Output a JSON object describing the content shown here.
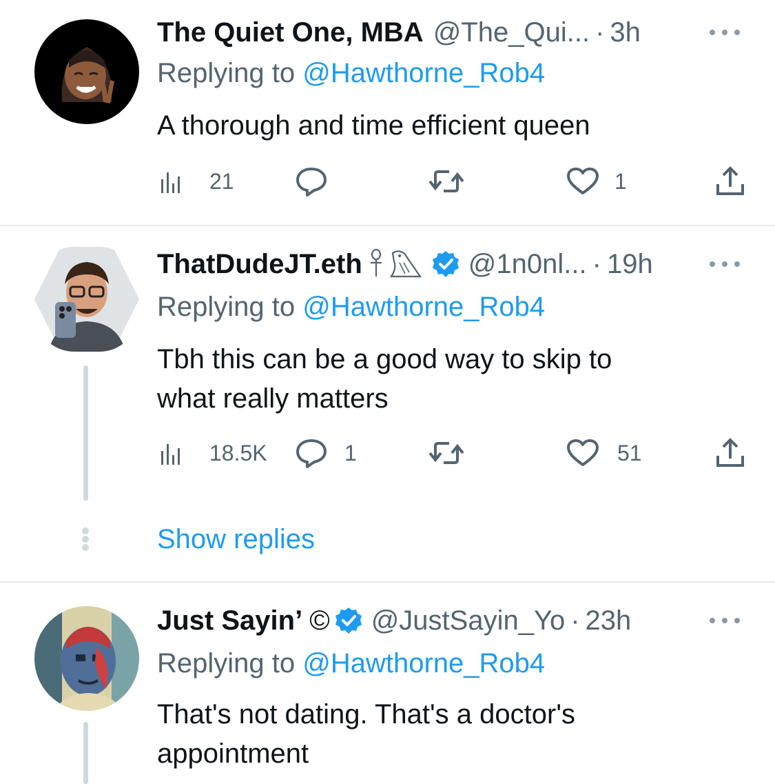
{
  "tweets": [
    {
      "name": "The Quiet One, MBA",
      "handle": "@The_Qui...",
      "dot": "·",
      "time": "3h",
      "replying_prefix": "Replying to ",
      "replying_to": "@Hawthorne_Rob4",
      "text": "A thorough and time efficient queen",
      "views": "21",
      "replies": "",
      "retweets": "",
      "likes": "1"
    },
    {
      "name": "ThatDudeJT.eth",
      "name_suffix_glyphs": "☥ 𓅓",
      "handle": "@1n0nl...",
      "dot": "·",
      "time": "19h",
      "replying_prefix": "Replying to ",
      "replying_to": "@Hawthorne_Rob4",
      "text": "Tbh this can be a good way to skip to\nwhat really matters",
      "views": "18.5K",
      "replies": "1",
      "retweets": "",
      "likes": "51",
      "verified": true
    },
    {
      "name": "Just Sayin’",
      "name_suffix_glyphs": "©",
      "handle": "@JustSayin_Yo",
      "dot": "·",
      "time": "23h",
      "replying_prefix": "Replying to ",
      "replying_to": "@Hawthorne_Rob4",
      "text": "That's not dating. That's a doctor's\nappointment",
      "verified": true
    }
  ],
  "show_replies_label": "Show replies",
  "icons": {
    "views": "bar-chart-icon",
    "reply": "speech-bubble-icon",
    "retweet": "retweet-arrows-icon",
    "like": "heart-icon",
    "share": "share-upload-icon",
    "more": "more-horizontal-icon",
    "verified": "verified-badge-icon"
  },
  "colors": {
    "link": "#1d9bf0",
    "secondary_text": "#536471",
    "primary_text": "#0f1419",
    "divider": "#e6e9ec",
    "thread_line": "#cfd9de"
  }
}
